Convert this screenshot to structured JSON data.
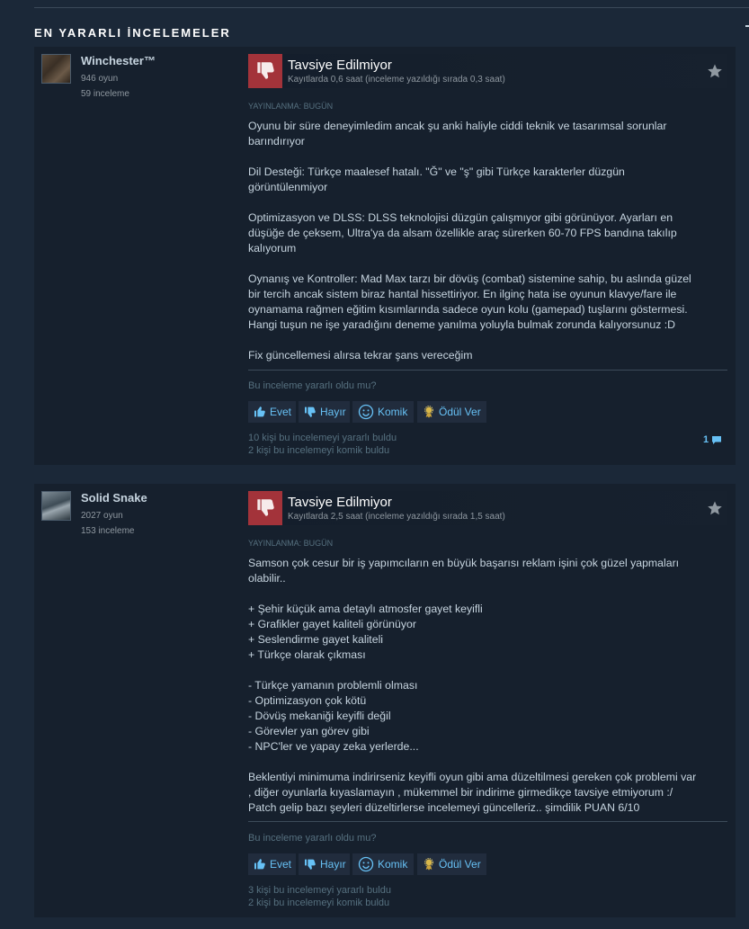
{
  "section": {
    "title": "EN YARARLI İNCELEMELER"
  },
  "reviews": [
    {
      "author": {
        "name": "Winchester™",
        "games": "946 oyun",
        "reviews": "59 inceleme"
      },
      "verdict": "Tavsiye Edilmiyor",
      "hours": "Kayıtlarda 0,6 saat (inceleme yazıldığı sırada 0,3 saat)",
      "posted": "YAYINLANMA: BUGÜN",
      "paragraphs": [
        [
          "Oyunu bir süre deneyimledim ancak şu anki haliyle ciddi teknik ve tasarımsal sorunlar",
          "barındırıyor"
        ],
        [
          "Dil Desteği: Türkçe maalesef hatalı. \"Ğ\" ve \"ş\" gibi Türkçe karakterler düzgün",
          "görüntülenmiyor"
        ],
        [
          "Optimizasyon ve DLSS: DLSS teknolojisi düzgün çalışmıyor gibi görünüyor. Ayarları en",
          "düşüğe de çeksem, Ultra'ya da alsam özellikle araç sürerken 60-70 FPS bandına takılıp",
          "kalıyorum"
        ],
        [
          "Oynanış ve Kontroller: Mad Max tarzı bir dövüş (combat) sistemine sahip, bu aslında güzel",
          "bir tercih ancak sistem biraz hantal hissettiriyor. En ilginç hata ise oyunun klavye/fare ile",
          "oynamama rağmen eğitim kısımlarında sadece oyun kolu (gamepad) tuşlarını göstermesi.",
          "Hangi tuşun ne işe yaradığını deneme yanılma yoluyla bulmak zorunda kalıyorsunuz :D"
        ],
        [
          "Fix güncellemesi alırsa tekrar şans vereceğim"
        ]
      ],
      "helpful_question": "Bu inceleme yararlı oldu mu?",
      "buttons": {
        "yes": "Evet",
        "no": "Hayır",
        "funny": "Komik",
        "award": "Ödül Ver"
      },
      "found_helpful": "10 kişi bu incelemeyi yararlı buldu",
      "found_funny": "2 kişi bu incelemeyi komik buldu",
      "comments": "1"
    },
    {
      "author": {
        "name": "Solid Snake",
        "games": "2027 oyun",
        "reviews": "153 inceleme"
      },
      "verdict": "Tavsiye Edilmiyor",
      "hours": "Kayıtlarda 2,5 saat (inceleme yazıldığı sırada 1,5 saat)",
      "posted": "YAYINLANMA: BUGÜN",
      "paragraphs": [
        [
          "Samson çok cesur bir iş yapımcıların en büyük başarısı reklam işini çok güzel yapmaları",
          "olabilir.."
        ],
        [
          "+ Şehir küçük ama detaylı atmosfer gayet keyifli",
          "+ Grafikler gayet kaliteli görünüyor",
          "+ Seslendirme gayet kaliteli",
          "+ Türkçe olarak çıkması"
        ],
        [
          "- Türkçe yamanın problemli olması",
          "- Optimizasyon çok kötü",
          "- Dövüş mekaniği keyifli değil",
          "- Görevler yan görev gibi",
          "- NPC'ler ve yapay zeka yerlerde..."
        ],
        [
          "Beklentiyi minimuma indirirseniz keyifli oyun gibi ama düzeltilmesi gereken çok problemi var",
          ", diğer oyunlarla kıyaslamayın , mükemmel bir indirime girmedikçe tavsiye etmiyorum :/",
          "Patch gelip bazı şeyleri düzeltirlerse incelemeyi güncelleriz.. şimdilik PUAN 6/10"
        ]
      ],
      "helpful_question": "Bu inceleme yararlı oldu mu?",
      "buttons": {
        "yes": "Evet",
        "no": "Hayır",
        "funny": "Komik",
        "award": "Ödül Ver"
      },
      "found_helpful": "3 kişi bu incelemeyi yararlı buldu",
      "found_funny": "2 kişi bu incelemeyi komik buldu"
    }
  ],
  "colors": {
    "background": "#1b2838",
    "panel": "#16202d",
    "thumbs_down": "#a3333a",
    "link": "#67c1f5"
  },
  "icons": [
    "thumbs-down-icon",
    "star-icon",
    "thumbs-up-icon",
    "smiley-icon",
    "award-icon",
    "comment-icon"
  ]
}
